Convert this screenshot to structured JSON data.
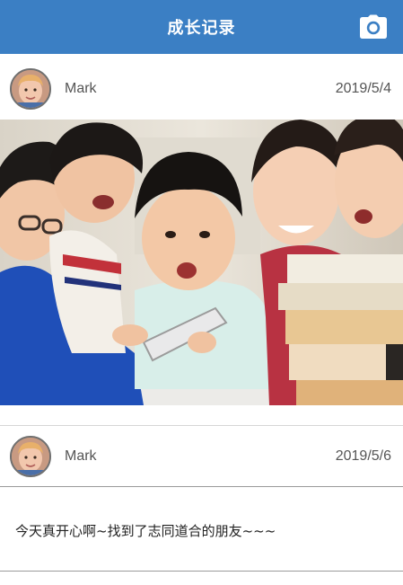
{
  "header": {
    "title": "成长记录",
    "camera_icon": "camera-icon",
    "bg_color": "#3b7fc4"
  },
  "posts": [
    {
      "author": "Mark",
      "date": "2019/5/4",
      "avatar_icon": "child-avatar",
      "has_photo": true
    },
    {
      "author": "Mark",
      "date": "2019/5/6",
      "avatar_icon": "child-avatar",
      "text": "今天真开心啊~找到了志同道合的朋友~~~"
    }
  ]
}
